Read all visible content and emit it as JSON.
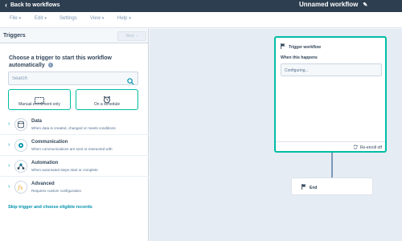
{
  "topbar": {
    "back_label": "Back to workflows",
    "workflow_title": "Unnamed workflow"
  },
  "menu": [
    {
      "label": "File"
    },
    {
      "label": "Edit"
    },
    {
      "label": "Settings"
    },
    {
      "label": "View"
    },
    {
      "label": "Help"
    }
  ],
  "sidebar": {
    "title": "Triggers",
    "next_label": "Next",
    "choose_heading": "Choose a trigger to start this workflow automatically",
    "search_placeholder": "Search",
    "options": [
      {
        "label": "Manual enrollment only",
        "icon": "dashed-box-icon"
      },
      {
        "label": "On a schedule",
        "icon": "alarm-clock-icon"
      }
    ],
    "categories": [
      {
        "title": "Data",
        "description": "When data is created, changed or meets conditions",
        "icon": "data-icon"
      },
      {
        "title": "Communication",
        "description": "When communications are sent or interacted with",
        "icon": "communication-icon"
      },
      {
        "title": "Automation",
        "description": "When automated steps start or complete",
        "icon": "automation-icon"
      },
      {
        "title": "Advanced",
        "description": "Requires custom configuration",
        "icon": "function-icon"
      }
    ],
    "skip_label": "Skip trigger and choose eligible records"
  },
  "canvas": {
    "trigger_card": {
      "title": "Trigger workflow",
      "subtitle": "When this happens",
      "status": "Configuring...",
      "reenroll_label": "Re-enroll off"
    },
    "end_card": {
      "label": "End"
    }
  },
  "colors": {
    "topbar": "#2d3e50",
    "accent_teal": "#00bda5",
    "link": "#0091ae",
    "canvas_bg": "#e5ecf3"
  }
}
